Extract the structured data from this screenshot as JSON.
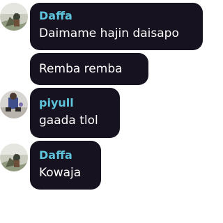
{
  "messages": [
    {
      "author": "Daffa",
      "text": "Daimame hajin daisapo"
    },
    {
      "author": "",
      "text": "Remba remba"
    },
    {
      "author": "piyull",
      "text": "gaada tlol"
    },
    {
      "author": "Daffa",
      "text": "Kowaja"
    }
  ],
  "colors": {
    "bubble": "#17121f",
    "author_name": "#5ec4dc",
    "message_text": "#ffffff",
    "background": "#ffffff"
  }
}
